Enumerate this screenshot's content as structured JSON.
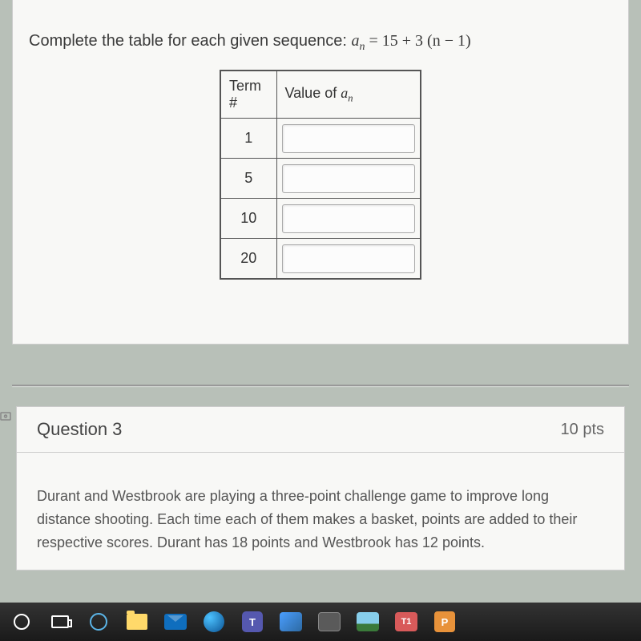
{
  "question2": {
    "prompt_prefix": "Complete the table for each given sequence: ",
    "formula_var": "a",
    "formula_sub": "n",
    "formula_eq": " = 15 + 3 (n − 1)",
    "table": {
      "header_term": "Term #",
      "header_value_prefix": "Value of ",
      "header_value_var": "a",
      "header_value_sub": "n",
      "rows": [
        {
          "term": "1",
          "value": ""
        },
        {
          "term": "5",
          "value": ""
        },
        {
          "term": "10",
          "value": ""
        },
        {
          "term": "20",
          "value": ""
        }
      ]
    }
  },
  "question3": {
    "title": "Question 3",
    "points": "10 pts",
    "body": "Durant and Westbrook are playing a three-point challenge game to improve long distance shooting. Each time each of them makes a basket, points are added to their respective scores. Durant has 18 points and Westbrook has 12 points."
  },
  "taskbar": {
    "teams_letter": "T",
    "t1_letter": "T1",
    "p_letter": "P"
  }
}
